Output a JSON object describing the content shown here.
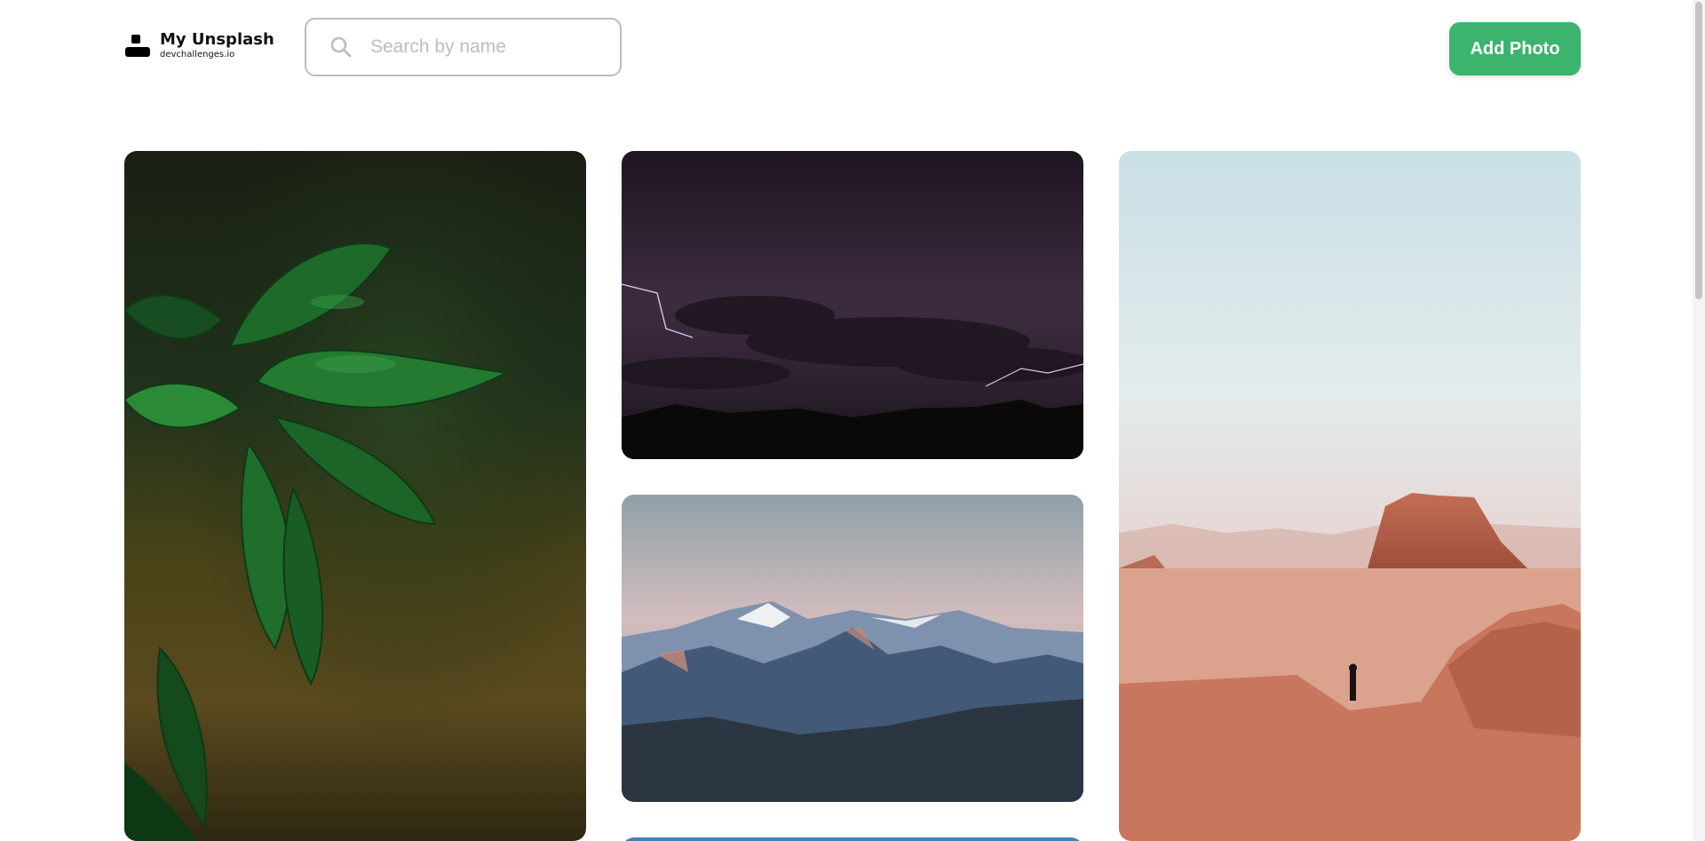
{
  "header": {
    "logo_title": "My Unsplash",
    "logo_subtitle": "devchallenges.io",
    "search_placeholder": "Search by name",
    "add_photo_label": "Add Photo"
  },
  "colors": {
    "accent": "#3db46d",
    "search_border": "#bdbdbd",
    "placeholder": "#bdbdbd"
  },
  "icons": {
    "logo": "unsplash-person-logo-icon",
    "search": "search-icon"
  },
  "gallery": {
    "photos": [
      {
        "subject": "green-leaves-with-raindrops"
      },
      {
        "subject": "night-sky-with-lightning"
      },
      {
        "subject": "snowy-mountain-range-at-dusk"
      },
      {
        "subject": "desert-with-lone-person-on-rock"
      },
      {
        "subject": "blue-sky-partial"
      }
    ]
  }
}
